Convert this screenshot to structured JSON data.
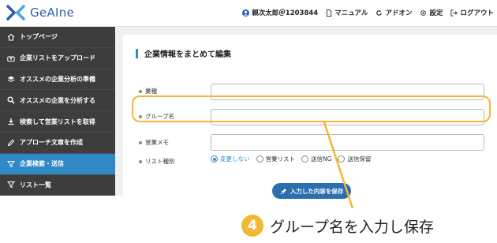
{
  "app": {
    "logo_text": "GeAIne"
  },
  "topnav": {
    "user": "親次太郎＠1203844",
    "manual": "マニュアル",
    "addon": "アドオン",
    "settings": "設定",
    "logout": "ログアウト"
  },
  "sidebar": {
    "items": [
      {
        "label": "トップページ",
        "icon": "home-icon"
      },
      {
        "label": "企業リストをアップロード",
        "icon": "upload-icon"
      },
      {
        "label": "オススメの企業分析の準備",
        "icon": "layers-icon"
      },
      {
        "label": "オススメの企業を分析する",
        "icon": "search-icon"
      },
      {
        "label": "検索して営業リストを取得",
        "icon": "download-icon"
      },
      {
        "label": "アプローチ文章を作成",
        "icon": "pen-icon"
      },
      {
        "label": "企業検索・送信",
        "icon": "filter-icon",
        "active": true
      },
      {
        "label": "リスト一覧",
        "icon": "filter-icon"
      }
    ]
  },
  "form": {
    "heading": "企業情報をまとめて編集",
    "industry_label": "業種",
    "group_label": "グループ名",
    "memo_label": "営業メモ",
    "list_type_label": "リスト種別",
    "industry_value": "",
    "group_value": "",
    "memo_value": "",
    "radio_options": [
      "変更しない",
      "営業リスト",
      "送信NG",
      "送信保留"
    ],
    "selected_radio": "変更しない",
    "save_label": "入力した内容を保存"
  },
  "annotation": {
    "step_number": "4",
    "caption": "グループ名を入力し保存",
    "highlight_color": "#f2b833"
  },
  "colors": {
    "accent": "#2f89c5",
    "sidebar_bg": "#3d3d3d",
    "button": "#2b6fae"
  }
}
